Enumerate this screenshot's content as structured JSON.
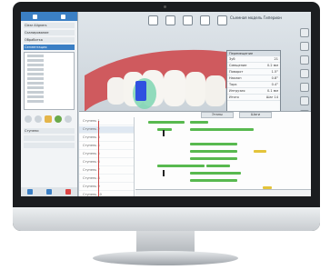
{
  "app": {
    "title_right": "Съемная модель Гиперион"
  },
  "left_panel": {
    "rows": [
      "Clear Aligners",
      "Сканирование",
      "Обработка",
      "Сегментация",
      "Ступени"
    ],
    "selected_row": "Сегментация",
    "list_count": 11
  },
  "dialog": {
    "header": "Перемещение",
    "rows": [
      {
        "label": "Зуб",
        "value": "21"
      },
      {
        "label": "Смещение",
        "value": "0.2 мм"
      },
      {
        "label": "Поворот",
        "value": "1.5°"
      },
      {
        "label": "Наклон",
        "value": "0.8°"
      },
      {
        "label": "Торк",
        "value": "0.4°"
      },
      {
        "label": "Интрузия",
        "value": "0.1 мм"
      },
      {
        "label": "Итого",
        "value": "Шаг 14"
      }
    ]
  },
  "timeline": {
    "tabs": [
      "Этапы",
      "Шаги"
    ],
    "tree_rows": [
      "Ступень 1",
      "Ступень 2",
      "Ступень 3",
      "Ступень 4",
      "Ступень 5",
      "Ступень 6",
      "Ступень 7",
      "Ступень 8",
      "Ступень 9",
      "Ступень 10"
    ],
    "selected_row": 1
  },
  "colors": {
    "accent": "#3b7fc4",
    "bar": "#58b94f",
    "bar_alt": "#e4c43a",
    "gum": "#cf5a5e",
    "highlight_tooth": "#2f50e0"
  }
}
